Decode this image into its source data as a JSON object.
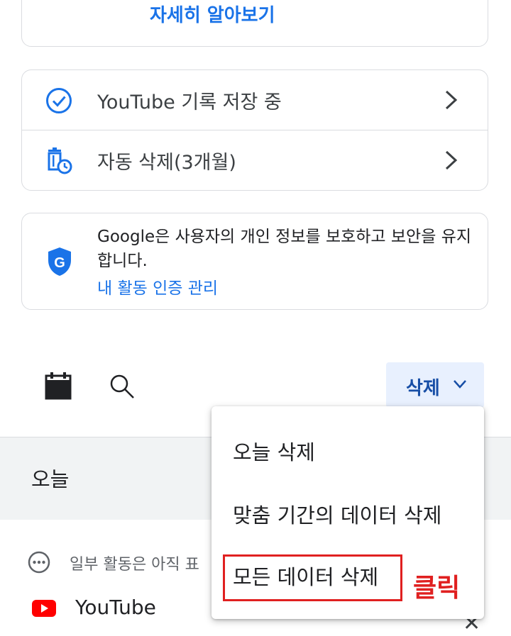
{
  "learn_more": "자세히 알아보기",
  "settings": {
    "history": "YouTube 기록 저장 중",
    "autodelete": "자동 삭제(3개월)"
  },
  "privacy": {
    "text": "Google은 사용자의 개인 정보를 보호하고 보안을 유지합니다.",
    "link": "내 활동 인증 관리"
  },
  "toolbar": {
    "delete_label": "삭제"
  },
  "today": {
    "label": "오늘"
  },
  "notice": "일부 활동은 아직 표",
  "item": {
    "app": "YouTube"
  },
  "menu": {
    "items": [
      "오늘 삭제",
      "맞춤 기간의 데이터 삭제",
      "모든 데이터 삭제"
    ]
  },
  "annotation": "클릭",
  "colors": {
    "accent": "#1a73e8",
    "highlight": "#e02020",
    "youtube": "#ff0000"
  }
}
